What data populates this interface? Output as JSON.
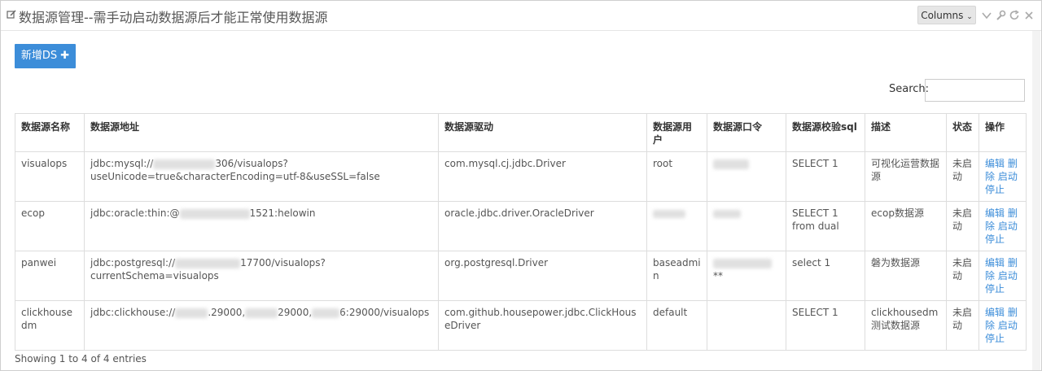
{
  "header": {
    "title": "数据源管理--需手动启动数据源后才能正常使用数据源",
    "columns_label": "Columns"
  },
  "toolbar": {
    "add_label": "新增DS"
  },
  "search": {
    "label": "Search:",
    "value": ""
  },
  "table": {
    "columns": [
      "数据源名称",
      "数据源地址",
      "数据源驱动",
      "数据源用户",
      "数据源口令",
      "数据源校验sql",
      "描述",
      "状态",
      "操作"
    ],
    "rows": [
      {
        "name": "visualops",
        "url_a": "jdbc:mysql://",
        "url_b": "306/visualops?useUnicode=true&characterEncoding=utf-8&useSSL=false",
        "driver": "com.mysql.cj.jdbc.Driver",
        "user": "root",
        "password": "",
        "sql": "SELECT 1",
        "desc": "可视化运营数据源",
        "status": "未启动"
      },
      {
        "name": "ecop",
        "url_a": "jdbc:oracle:thin:@",
        "url_b": "1521:helowin",
        "driver": "oracle.jdbc.driver.OracleDriver",
        "user": "",
        "password": "",
        "sql": "SELECT 1 from dual",
        "desc": "ecop数据源",
        "status": "未启动"
      },
      {
        "name": "panwei",
        "url_a": "jdbc:postgresql://",
        "url_b": "17700/visualops?currentSchema=visualops",
        "driver": "org.postgresql.Driver",
        "user": "baseadmin",
        "password": "**",
        "sql": "select 1",
        "desc": "磐为数据源",
        "status": "未启动"
      },
      {
        "name": "clickhousedm",
        "url_a": "jdbc:clickhouse://",
        "url_b": ".29000,",
        "url_c": "29000,",
        "url_d": "6:29000/visualops",
        "driver": "com.github.housepower.jdbc.ClickHouseDriver",
        "user": "default",
        "password": "",
        "sql": "SELECT 1",
        "desc": "clickhousedm测试数据源",
        "status": "未启动"
      }
    ],
    "actions": {
      "edit": "编辑",
      "delete": "删除",
      "start": "启动",
      "stop": "停止"
    }
  },
  "footer": {
    "info": "Showing 1 to 4 of 4 entries"
  },
  "colors": {
    "accent": "#3c8dd9",
    "border": "#dddddd"
  }
}
